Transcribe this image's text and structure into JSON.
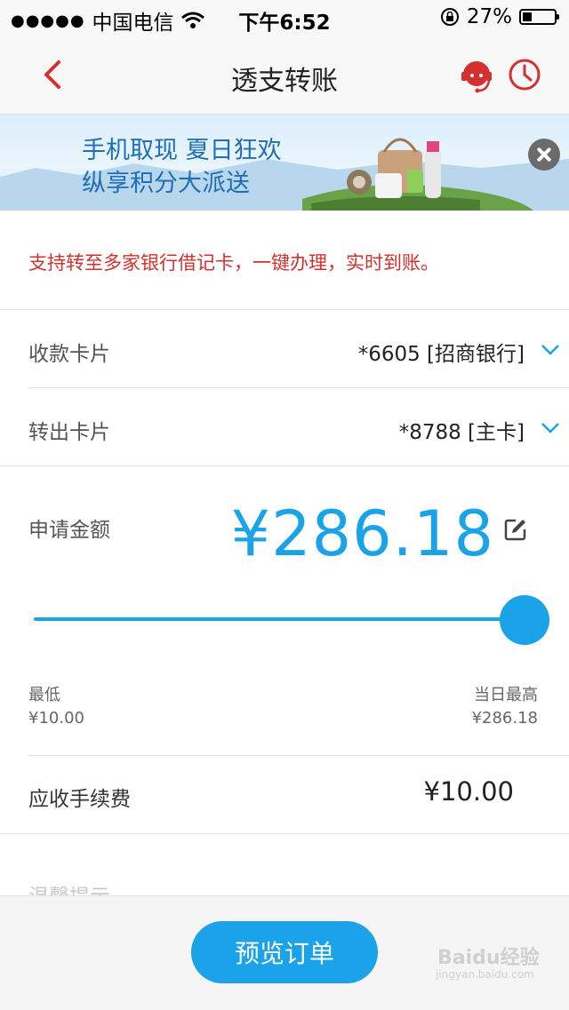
{
  "status_bar": {
    "signal_dots": "●●●●●",
    "carrier": "中国电信",
    "time": "下午6:52",
    "battery_percent": "27%"
  },
  "nav": {
    "title": "透支转账"
  },
  "banner": {
    "line1": "手机取现 夏日狂欢",
    "line2": "纵享积分大派送"
  },
  "notice": "支持转至多家银行借记卡，一键办理，实时到账。",
  "receive_card": {
    "label": "收款卡片",
    "value": "*6605 [招商银行]"
  },
  "outgoing_card": {
    "label": "转出卡片",
    "value": "*8788 [主卡]"
  },
  "amount": {
    "label": "申请金额",
    "value": "¥286.18",
    "slider_fraction": 1.0
  },
  "range": {
    "min_label": "最低",
    "min_value": "¥10.00",
    "max_label": "当日最高",
    "max_value": "¥286.18"
  },
  "fee": {
    "label": "应收手续费",
    "value": "¥10.00"
  },
  "tips_label": "温馨提示",
  "preview_button": "预览订单",
  "watermark": {
    "logo": "Baidu经验",
    "url": "jingyan.baidu.com"
  },
  "colors": {
    "accent": "#1aa3e8",
    "notice": "#d3302f",
    "nav_icon": "#d3302f"
  }
}
